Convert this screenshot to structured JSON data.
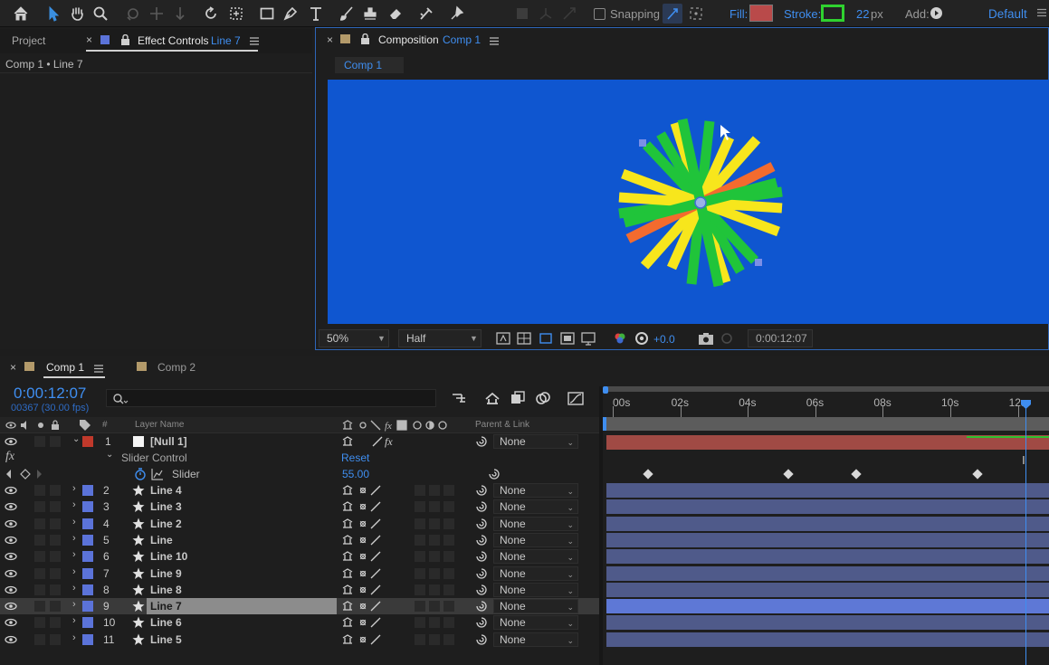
{
  "toolbar": {
    "snapping_label": "Snapping",
    "fill_label": "Fill:",
    "stroke_label": "Stroke:",
    "stroke_width": "22",
    "stroke_unit": "px",
    "add_label": "Add:",
    "workspace": "Default",
    "colors": {
      "fill_swatch": "#b94a4a",
      "stroke_swatch": "#2fd22f"
    }
  },
  "left_panel": {
    "tab_project": "Project",
    "tab_effect_controls": "Effect Controls",
    "tab_effect_layer": "Line 7",
    "breadcrumb": "Comp 1 • Line 7"
  },
  "comp_panel": {
    "tab_label": "Composition",
    "tab_comp": "Comp 1",
    "sub_tab": "Comp 1",
    "canvas_color": "#0f56d0",
    "zoom": "50%",
    "resolution": "Half",
    "exposure": "+0.0",
    "timecode": "0:00:12:07"
  },
  "timeline": {
    "tab_active": "Comp 1",
    "tab_other": "Comp 2",
    "current_time": "0:00:12:07",
    "frame_info": "00367 (30.00 fps)",
    "search_placeholder": "",
    "col_hash": "#",
    "col_layer_name": "Layer Name",
    "col_parent": "Parent & Link",
    "ruler_ticks": [
      "00s",
      "02s",
      "04s",
      "06s",
      "08s",
      "10s",
      "12s"
    ],
    "null_layer": {
      "num": "1",
      "name": "[Null 1]",
      "parent": "None",
      "color": "#c0392b"
    },
    "effect_row": {
      "fx": "fx",
      "name": "Slider Control",
      "reset": "Reset"
    },
    "slider_row": {
      "name": "Slider",
      "value": "55.00"
    },
    "keyframe_times_s": [
      1.05,
      5.2,
      7.2,
      10.8
    ],
    "playhead_time_s": 12.23,
    "layers": [
      {
        "num": "2",
        "name": "Line 4",
        "parent": "None"
      },
      {
        "num": "3",
        "name": "Line 3",
        "parent": "None"
      },
      {
        "num": "4",
        "name": "Line 2",
        "parent": "None"
      },
      {
        "num": "5",
        "name": "Line",
        "parent": "None"
      },
      {
        "num": "6",
        "name": "Line 10",
        "parent": "None"
      },
      {
        "num": "7",
        "name": "Line 9",
        "parent": "None"
      },
      {
        "num": "8",
        "name": "Line 8",
        "parent": "None"
      },
      {
        "num": "9",
        "name": "Line 7",
        "parent": "None",
        "selected": true
      },
      {
        "num": "10",
        "name": "Line 6",
        "parent": "None"
      },
      {
        "num": "11",
        "name": "Line 5",
        "parent": "None"
      }
    ]
  }
}
